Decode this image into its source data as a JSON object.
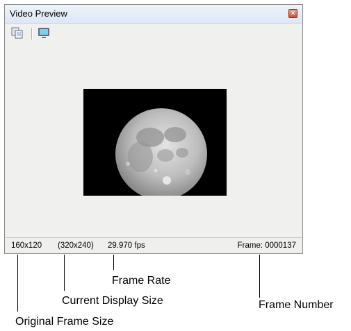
{
  "window": {
    "title": "Video Preview",
    "close_glyph": "×"
  },
  "toolbar": {
    "buttons": [
      {
        "icon": "copy-frame-icon"
      },
      {
        "icon": "external-monitor-icon"
      }
    ]
  },
  "preview": {
    "content": "moon-frame"
  },
  "status": {
    "original_size": "160x120",
    "display_size": "(320x240)",
    "frame_rate": "29.970 fps",
    "frame_number": "Frame: 0000137"
  },
  "callouts": {
    "frame_rate": "Frame Rate",
    "current_display_size": "Current Display Size",
    "frame_number": "Frame Number",
    "original_frame_size": "Original Frame Size"
  }
}
